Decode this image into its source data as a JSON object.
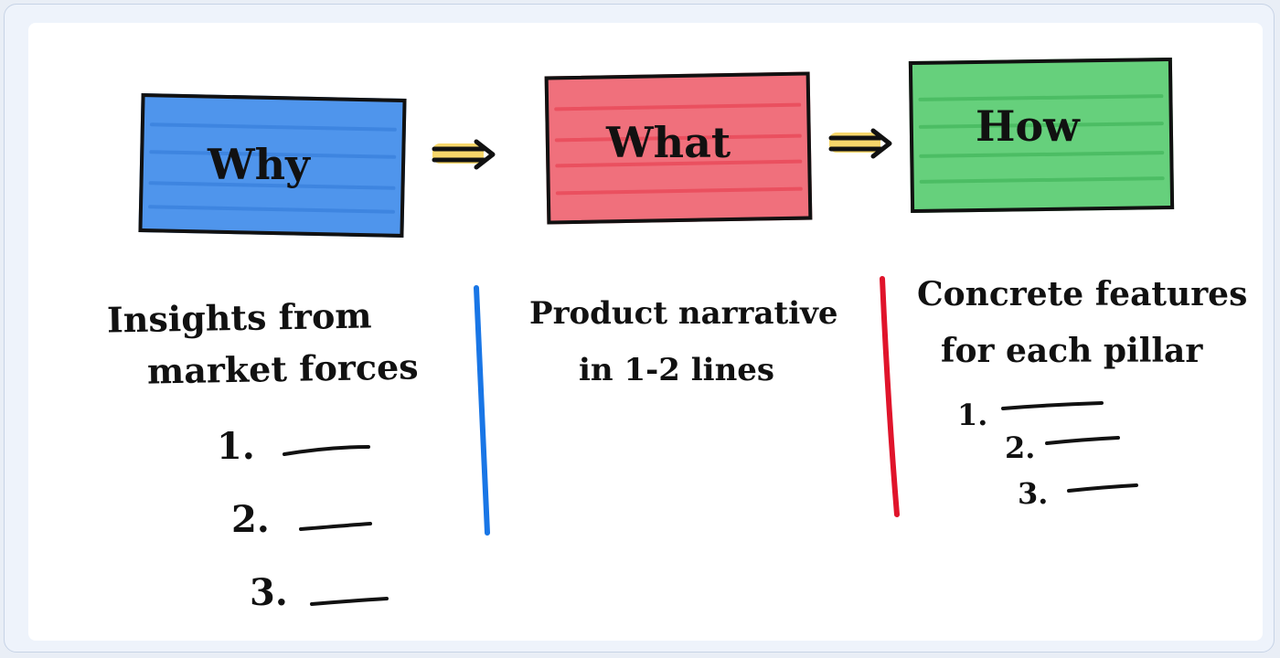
{
  "colors": {
    "why_fill": "#4f95ec",
    "what_fill": "#f0707c",
    "how_fill": "#66d07c",
    "arrow_fill": "#f6d35a",
    "divider_left": "#1976e6",
    "divider_right": "#e0142b",
    "ink": "#111111"
  },
  "boxes": {
    "why": "Why",
    "what": "What",
    "how": "How"
  },
  "columns": {
    "left": {
      "line1": "Insights from",
      "line2": "market forces",
      "items": [
        "1.",
        "2.",
        "3."
      ]
    },
    "middle": {
      "line1": "Product narrative",
      "line2": "in 1-2 lines"
    },
    "right": {
      "line1": "Concrete features",
      "line2": "for each pillar",
      "items": [
        "1.",
        "2.",
        "3."
      ]
    }
  },
  "icons": [
    "arrow-right-icon",
    "arrow-right-icon"
  ]
}
